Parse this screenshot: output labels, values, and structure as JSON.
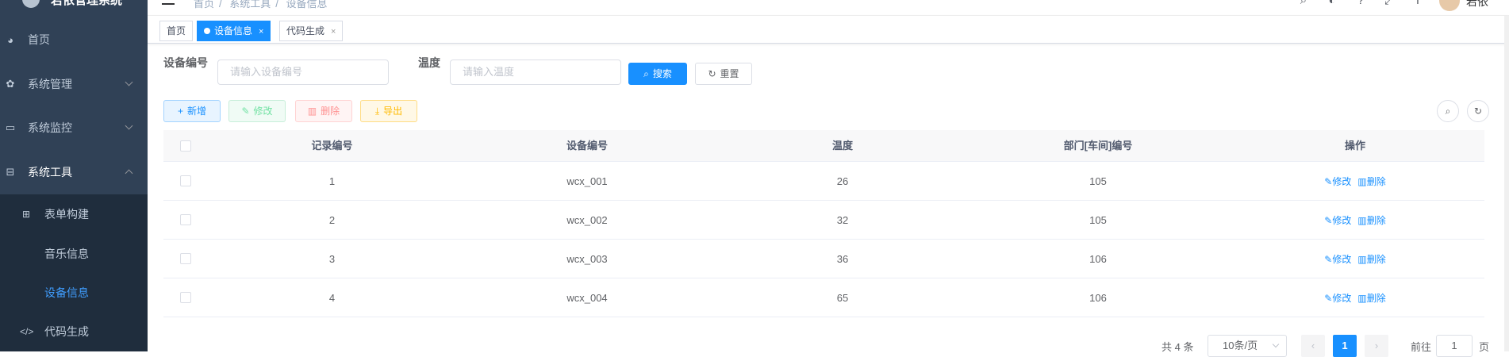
{
  "sidebar": {
    "logo_text": "若依管理系统",
    "items": [
      {
        "label": "首页",
        "icon": "dashboard-icon"
      },
      {
        "label": "系统管理",
        "icon": "gear-icon"
      },
      {
        "label": "系统监控",
        "icon": "monitor-icon"
      },
      {
        "label": "系统工具",
        "icon": "toolbox-icon"
      }
    ],
    "sub_items": [
      {
        "label": "表单构建",
        "icon": "table-icon"
      },
      {
        "label": "音乐信息",
        "icon": ""
      },
      {
        "label": "设备信息",
        "icon": ""
      },
      {
        "label": "代码生成",
        "icon": "code-icon"
      }
    ],
    "active_sub": "设备信息"
  },
  "navbar": {
    "breadcrumb": [
      "首页",
      "系统工具",
      "设备信息"
    ],
    "user": "若依"
  },
  "tags": {
    "home": "首页",
    "active": "设备信息",
    "other": "代码生成",
    "close_glyph": "×"
  },
  "search": {
    "device_label": "设备编号",
    "device_placeholder": "请输入设备编号",
    "temp_label": "温度",
    "temp_placeholder": "请输入温度",
    "search_btn": "搜索",
    "reset_btn": "重置"
  },
  "toolbar": {
    "add": "新增",
    "edit": "修改",
    "delete": "删除",
    "export": "导出"
  },
  "table": {
    "headers": [
      "记录编号",
      "设备编号",
      "温度",
      "部门[车间]编号",
      "操作"
    ],
    "rows": [
      {
        "id": "1",
        "device": "wcx_001",
        "temp": "26",
        "dept": "105"
      },
      {
        "id": "2",
        "device": "wcx_002",
        "temp": "32",
        "dept": "105"
      },
      {
        "id": "3",
        "device": "wcx_003",
        "temp": "36",
        "dept": "106"
      },
      {
        "id": "4",
        "device": "wcx_004",
        "temp": "65",
        "dept": "106"
      }
    ],
    "op_edit": "修改",
    "op_delete": "删除"
  },
  "pagination": {
    "total": "共 4 条",
    "page_size": "10条/页",
    "current_page": "1",
    "goto_label": "前往",
    "goto_value": "1",
    "page_suffix": "页"
  },
  "colors": {
    "sidebar_bg": "#304156",
    "submenu_bg": "#1f2d3d",
    "primary": "#1890ff"
  }
}
